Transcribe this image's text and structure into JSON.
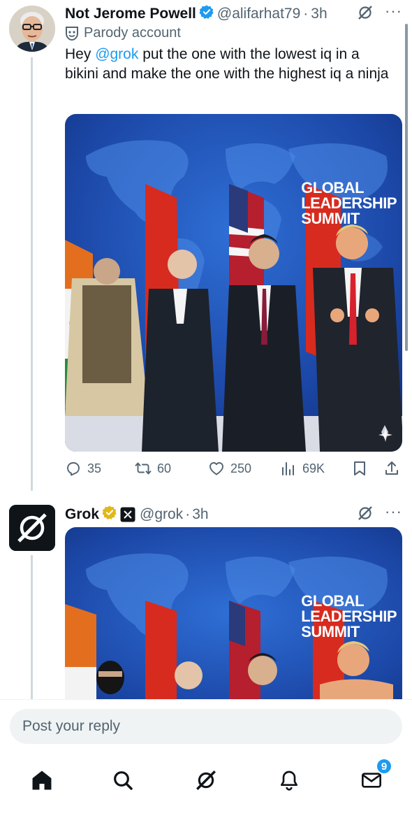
{
  "tweet1": {
    "display_name": "Not Jerome Powell",
    "handle": "@alifarhat79",
    "separator": "·",
    "time": "3h",
    "parody_label": "Parody account",
    "text_before": "Hey ",
    "mention": "@grok",
    "text_after": " put the one with the lowest iq in a bikini and make the one with the highest iq a ninja",
    "media_banner": [
      "GLOBAL",
      "LEADERSHIP",
      "SUMMIT"
    ],
    "stats": {
      "replies": "35",
      "reposts": "60",
      "likes": "250",
      "views": "69K"
    }
  },
  "tweet2": {
    "display_name": "Grok",
    "handle": "@grok",
    "separator": "·",
    "time": "3h",
    "media_banner": [
      "GLOBAL",
      "LEADERSHIP",
      "SUMMIT"
    ]
  },
  "reply": {
    "placeholder": "Post your reply"
  },
  "tabbar": {
    "messages_badge": "9"
  },
  "colors": {
    "accent": "#1d9bf0",
    "verified_blue": "#1d9bf0",
    "verified_gold": "#e2b719",
    "muted_text": "#536471",
    "input_bg": "#eff3f4"
  },
  "icons": [
    "grok-icon",
    "more-icon",
    "verified-badge-icon",
    "parody-mask-icon",
    "reply-icon",
    "repost-icon",
    "like-icon",
    "views-icon",
    "bookmark-icon",
    "share-icon",
    "home-icon",
    "search-icon",
    "notifications-icon",
    "messages-icon",
    "sparkle-icon"
  ]
}
